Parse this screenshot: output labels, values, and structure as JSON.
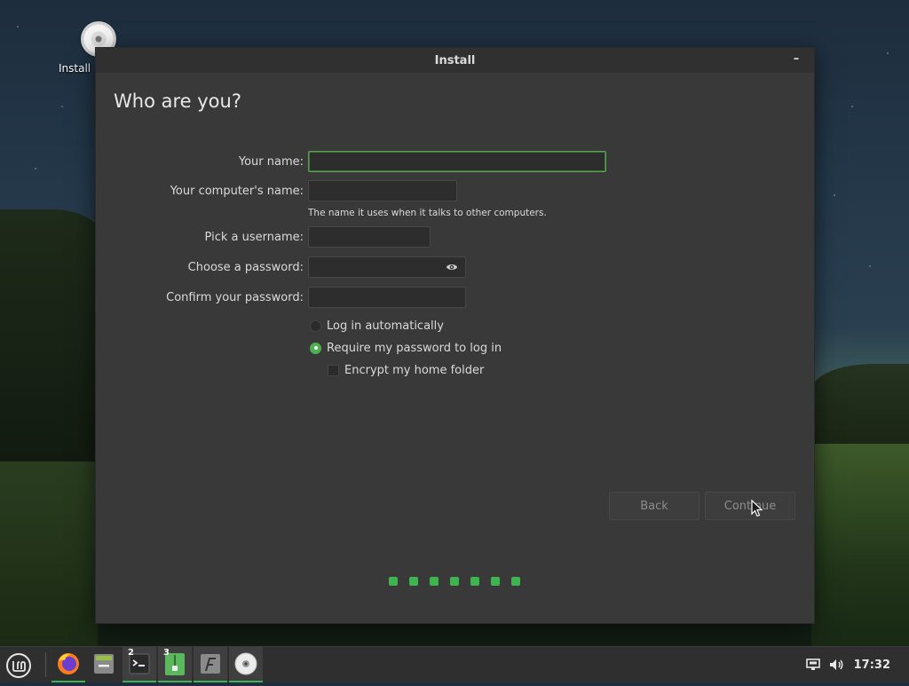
{
  "desktop": {
    "icons": [
      {
        "label": "Install",
        "icon": "disc-icon"
      }
    ]
  },
  "window": {
    "title": "Install",
    "minimize_glyph": "–",
    "heading": "Who are you?",
    "form": {
      "name_label": "Your name:",
      "name_value": "",
      "computer_label": "Your computer's name:",
      "computer_value": "",
      "computer_hint": "The name it uses when it talks to other computers.",
      "username_label": "Pick a username:",
      "username_value": "",
      "password_label": "Choose a password:",
      "password_value": "",
      "confirm_label": "Confirm your password:",
      "confirm_value": "",
      "login_auto_label": "Log in automatically",
      "login_auto_selected": false,
      "require_password_label": "Require my password to log in",
      "require_password_selected": true,
      "encrypt_label": "Encrypt my home folder",
      "encrypt_checked": false
    },
    "buttons": {
      "back": "Back",
      "continue": "Continue"
    },
    "progress": {
      "total_steps": 7,
      "accent": "#3fb34f"
    }
  },
  "taskbar": {
    "apps": [
      {
        "name": "firefox-icon",
        "badge": "",
        "running": true
      },
      {
        "name": "files-icon",
        "badge": "",
        "running": false
      },
      {
        "name": "terminal-icon",
        "badge": "2",
        "running": true
      },
      {
        "name": "archive-manager-icon",
        "badge": "3",
        "running": true
      },
      {
        "name": "font-viewer-icon",
        "badge": "",
        "running": true
      },
      {
        "name": "installer-disc-icon",
        "badge": "",
        "running": true
      }
    ],
    "tray": {
      "network_icon": "network-icon",
      "volume_icon": "volume-icon",
      "clock": "17:32"
    }
  },
  "colors": {
    "accent": "#3fb34f",
    "window_bg": "#393939",
    "titlebar_bg": "#303030",
    "taskbar_bg": "#2f2f2f"
  }
}
